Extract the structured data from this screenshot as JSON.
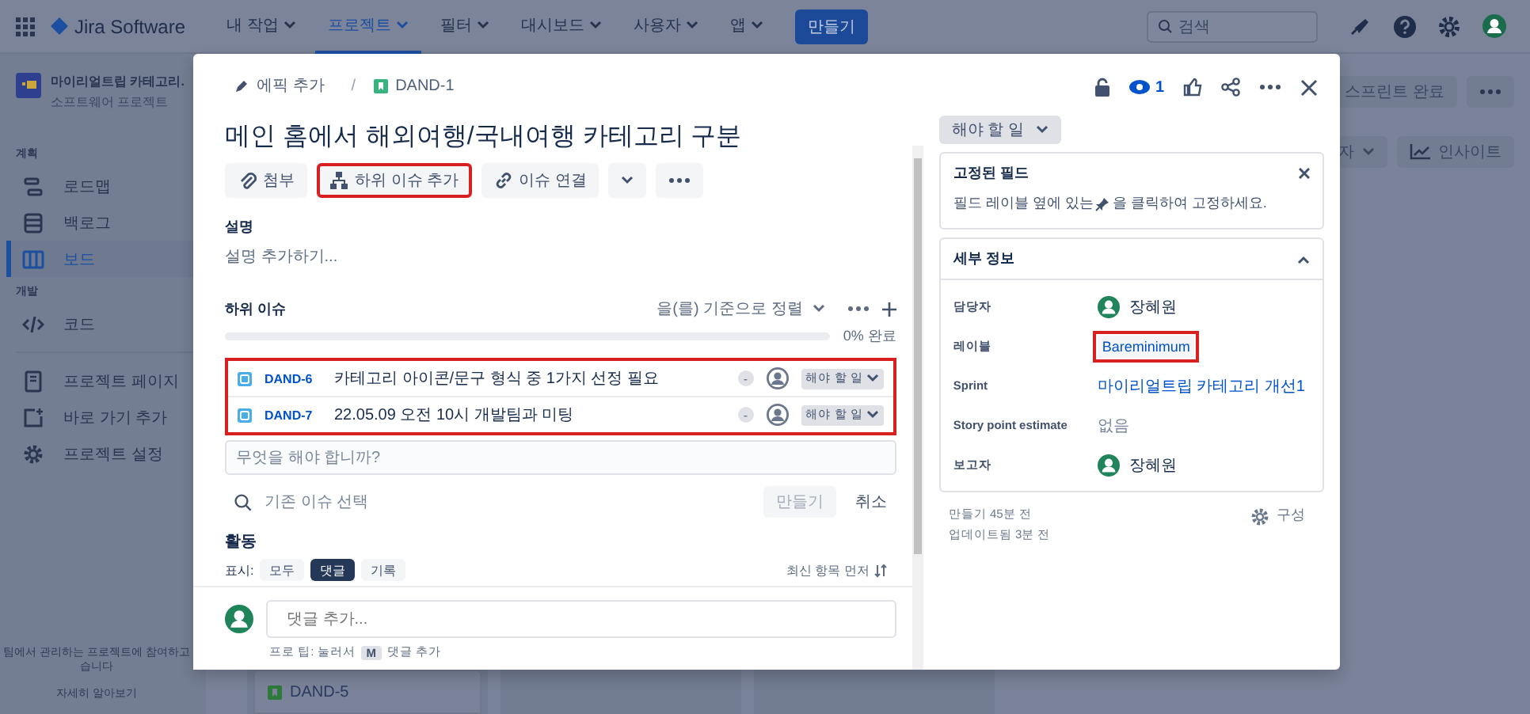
{
  "topnav": {
    "product": "Jira Software",
    "menus": [
      {
        "label": "내 작업",
        "selected": false
      },
      {
        "label": "프로젝트",
        "selected": true
      },
      {
        "label": "필터",
        "selected": false
      },
      {
        "label": "대시보드",
        "selected": false
      },
      {
        "label": "사용자",
        "selected": false
      },
      {
        "label": "앱",
        "selected": false
      }
    ],
    "create": "만들기",
    "search": {
      "placeholder": "검색"
    }
  },
  "sidebar": {
    "project": {
      "name": "마이리얼트립 카테고리.",
      "type": "소프트웨어 프로젝트"
    },
    "sections": [
      {
        "title": "계획",
        "items": [
          {
            "label": "로드맵",
            "kind": "roadmap",
            "selected": false
          },
          {
            "label": "백로그",
            "kind": "backlog",
            "selected": false
          },
          {
            "label": "보드",
            "kind": "board",
            "selected": true
          }
        ]
      },
      {
        "title": "개발",
        "items": [
          {
            "label": "코드",
            "kind": "code",
            "selected": false
          }
        ]
      }
    ],
    "links": [
      {
        "label": "프로젝트 페이지",
        "kind": "page"
      },
      {
        "label": "바로 가기 추가",
        "kind": "shortcut"
      },
      {
        "label": "프로젝트 설정",
        "kind": "settings"
      }
    ],
    "footer": {
      "lines": [
        "팀에서 관리하는 프로젝트에 참여하고",
        "습니다"
      ],
      "link": "자세히 알아보기"
    }
  },
  "board": {
    "complete_sprint": "스프린트 완료",
    "filter": "자",
    "insights": "인사이트",
    "card": {
      "key": "DAND-5"
    }
  },
  "issue": {
    "breadcrumb": {
      "epic": "에픽 추가",
      "separator": "/",
      "key": "DAND-1"
    },
    "title": "메인 홈에서 해외여행/국내여행 카테고리 구분",
    "actions": [
      {
        "label": "첨부",
        "kind": "attach",
        "highlighted": false
      },
      {
        "label": "하위 이슈 추가",
        "kind": "subtask",
        "highlighted": true
      },
      {
        "label": "이슈 연결",
        "kind": "link",
        "highlighted": false
      }
    ],
    "description": {
      "label": "설명",
      "placeholder": "설명 추가하기..."
    },
    "subtasks": {
      "title": "하위 이슈",
      "sort": "을(를) 기준으로 정렬",
      "progress": {
        "level": 0,
        "label": "0% 완료"
      },
      "highlighted": true,
      "rows": [
        {
          "key": "DAND-6",
          "summary": "카테고리 아이콘/문구 형식 중 1가지 선정 필요",
          "priority": "-",
          "status": "해야 할 일"
        },
        {
          "key": "DAND-7",
          "summary": "22.05.09 오전 10시 개발팀과 미팅",
          "priority": "-",
          "status": "해야 할 일"
        }
      ],
      "new_placeholder": "무엇을 해야 합니까?",
      "existing_placeholder": "기존 이슈 선택",
      "create": "만들기",
      "create_disabled": true,
      "cancel": "취소"
    },
    "activity": {
      "title": "활동",
      "show_label": "표시:",
      "filters": [
        {
          "label": "모두",
          "selected": false
        },
        {
          "label": "댓글",
          "selected": true
        },
        {
          "label": "기록",
          "selected": false
        }
      ],
      "sort": "최신 항목 먼저"
    },
    "comment": {
      "placeholder": "댓글 추가...",
      "tip_before": "프로 팁: 눌러서",
      "tip_key": "M",
      "tip_after": "댓글 추가"
    },
    "watchers": "1",
    "status": "해야 할 일",
    "pinned": {
      "title": "고정된 필드",
      "text_before": "필드 레이블 옆에 있는",
      "text_after": "을 클릭하여 고정하세요."
    },
    "details": {
      "title": "세부 정보",
      "expanded": true,
      "fields": [
        {
          "label": "담당자",
          "kind": "user",
          "value": "장혜원",
          "highlighted": false
        },
        {
          "label": "레이블",
          "kind": "tag",
          "value": "Bareminimum",
          "highlighted": true
        },
        {
          "label": "Sprint",
          "kind": "link",
          "value": "마이리얼트립 카테고리 개선1",
          "highlighted": false
        },
        {
          "label": "Story point estimate",
          "kind": "empty",
          "value": "없음",
          "highlighted": false
        },
        {
          "label": "보고자",
          "kind": "user",
          "value": "장혜원",
          "highlighted": false
        }
      ]
    },
    "created": "만들기 45분 전",
    "updated": "업데이트됨 3분 전",
    "configure": "구성"
  }
}
